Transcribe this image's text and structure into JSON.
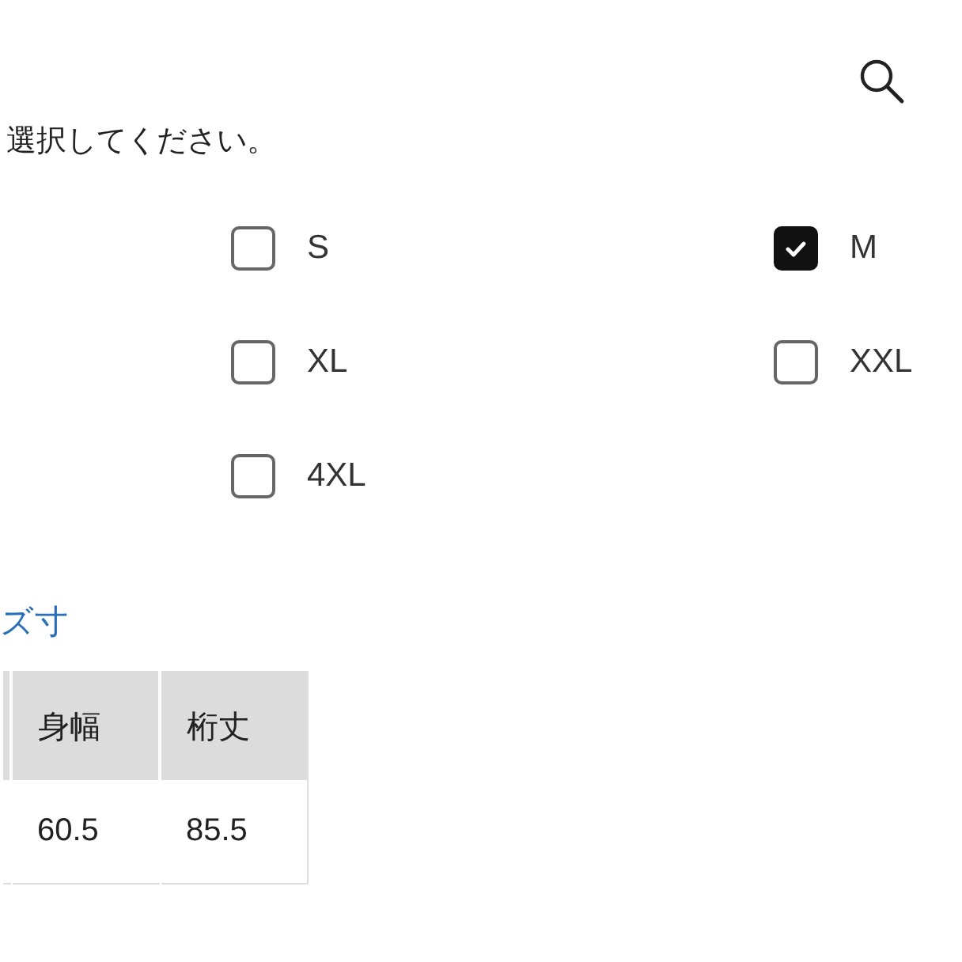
{
  "instruction": "選択してください。",
  "sizes": [
    {
      "label": "S",
      "checked": false
    },
    {
      "label": "M",
      "checked": true
    },
    {
      "label": "XL",
      "checked": false
    },
    {
      "label": "XXL",
      "checked": false
    },
    {
      "label": "4XL",
      "checked": false
    }
  ],
  "size_link": "ズ寸",
  "table": {
    "columns": [
      "身幅",
      "桁丈"
    ],
    "rows": [
      [
        "60.5",
        "85.5"
      ]
    ]
  }
}
